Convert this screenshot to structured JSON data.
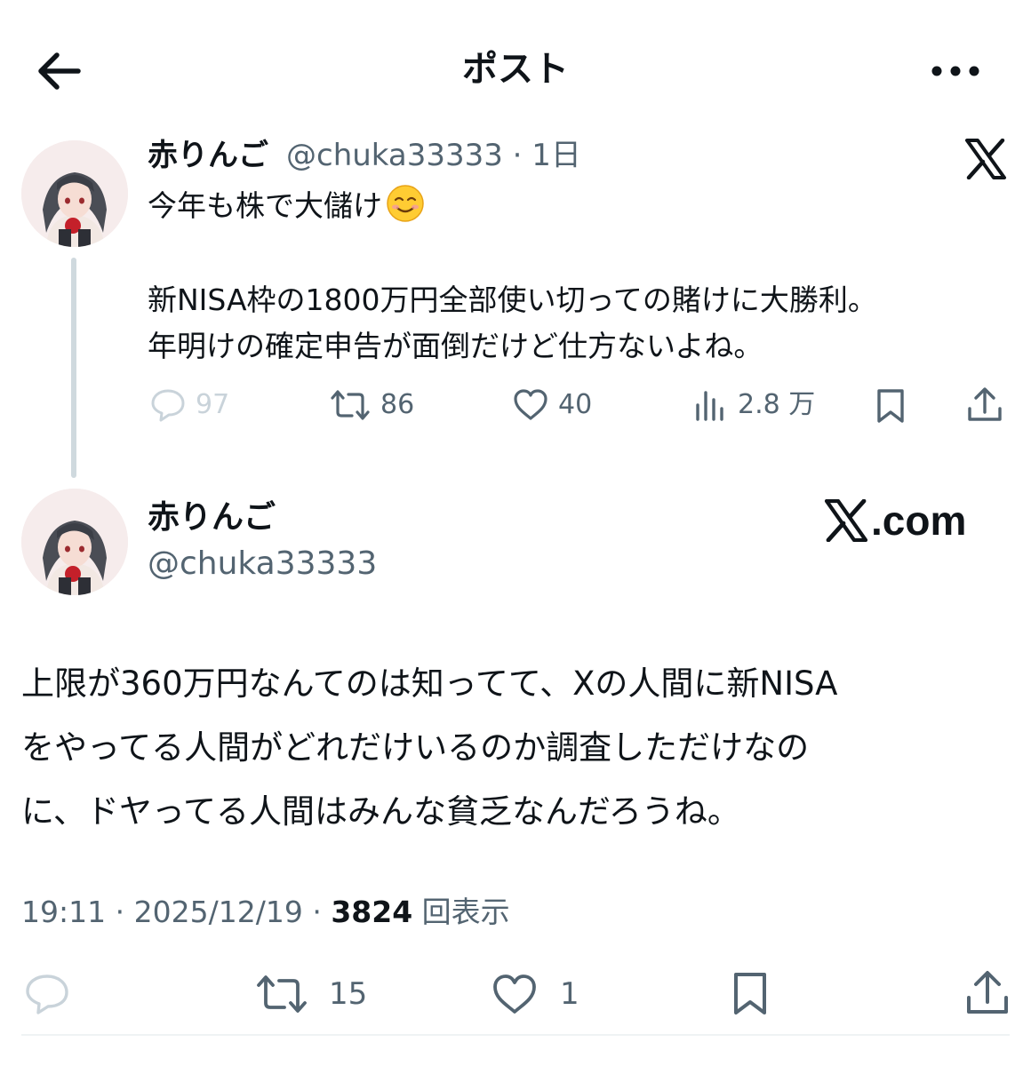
{
  "header": {
    "title": "ポスト"
  },
  "quoted_post": {
    "display_name": "赤りんご",
    "handle": "@chuka33333",
    "age": "1日",
    "meta": "@chuka33333 · 1日",
    "text_line1": "今年も株で大儲け",
    "emoji": "☺️",
    "text_line2": "",
    "text_line3": "新NISA枠の1800万円全部使い切っての賭けに大勝利。",
    "text_line4": "年明けの確定申告が面倒だけど仕方ないよね。",
    "replies": "97",
    "reposts": "86",
    "likes": "40",
    "views": "2.8 万"
  },
  "main_post": {
    "display_name": "赤りんご",
    "handle": "@chuka33333",
    "brand": ".com",
    "text_lines": [
      "上限が360万円なんてのは知ってて、Xの人間に新NISA",
      "をやってる人間がどれだけいるのか調査しただけなの",
      "に、ドヤってる人間はみんな貧乏なんだろうね。"
    ],
    "time": "19:11",
    "date": "2025/12/19",
    "views_count": "3824",
    "views_label": "回表示",
    "reposts": "15",
    "likes": "1"
  },
  "colors": {
    "text": "#0f1419",
    "secondary": "#536471",
    "muted": "#c9d3da",
    "thread_line": "#cfd9de"
  }
}
